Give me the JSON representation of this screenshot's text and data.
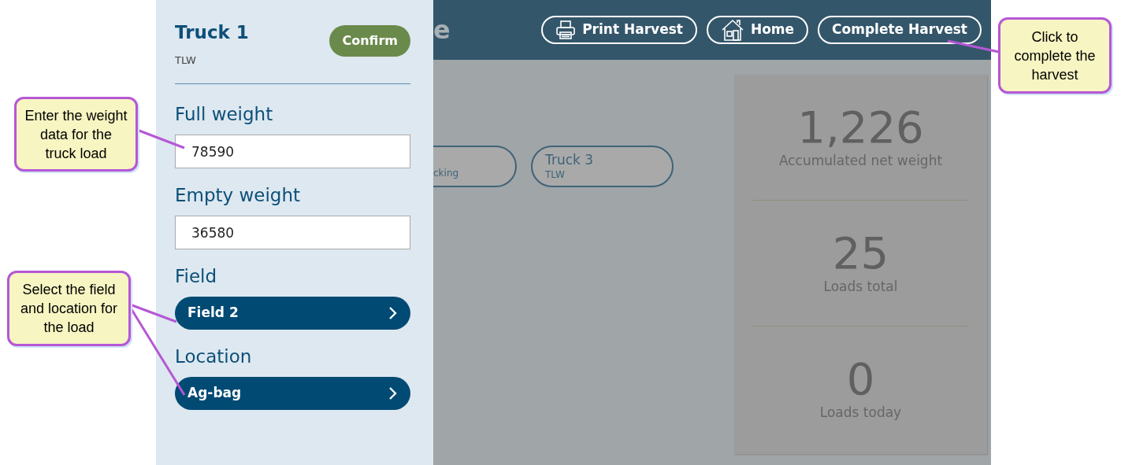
{
  "header": {
    "title": "e",
    "buttons": [
      {
        "label": "Print Harvest",
        "kind": "printer"
      },
      {
        "label": "Home",
        "kind": "house"
      },
      {
        "label": "Complete Harvest",
        "kind": "text"
      }
    ]
  },
  "trucks": [
    {
      "subtitle": "cking"
    },
    {
      "name": "Truck 3",
      "subtitle": "TLW"
    }
  ],
  "stats": [
    {
      "value": "1,226",
      "label": "Accumulated net weight"
    },
    {
      "value": "25",
      "label": "Loads total"
    },
    {
      "value": "0",
      "label": "Loads today"
    }
  ],
  "panel": {
    "title": "Truck 1",
    "subtitle": "TLW",
    "confirm": "Confirm",
    "fields": [
      {
        "label": "Full weight",
        "kind": "input",
        "value": "78590"
      },
      {
        "label": "Empty weight",
        "kind": "input",
        "value": "36580"
      },
      {
        "label": "Field",
        "kind": "select",
        "value": "Field 2"
      },
      {
        "label": "Location",
        "kind": "select",
        "value": "Ag-bag"
      }
    ]
  },
  "callouts": [
    {
      "text": "Enter the weight data for the truck load"
    },
    {
      "text": "Select the field and location for the load"
    },
    {
      "text": "Click to complete the harvest"
    }
  ]
}
